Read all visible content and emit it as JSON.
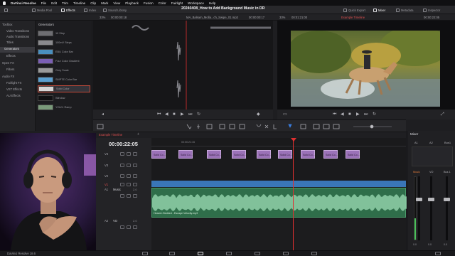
{
  "menu": {
    "app": "DaVinci Resolve",
    "items": [
      "File",
      "Edit",
      "Trim",
      "Timeline",
      "Clip",
      "Mark",
      "View",
      "Playback",
      "Fusion",
      "Color",
      "Fairlight",
      "Workspace",
      "Help"
    ]
  },
  "toolbar": {
    "left": [
      "Media Pool",
      "Effects",
      "Index",
      "Sound Library"
    ],
    "title": "20240408_How to Add Background Music in DR",
    "right": [
      "Quick Export",
      "Mixer",
      "Metadata",
      "Inspector"
    ]
  },
  "subbar": {
    "src_zoom": "33%",
    "src_timecode": "00:00:00:18",
    "src_clip": "MA_Balsam_Molla...ch_Swipe_01.mp3",
    "src_timecode_end": "00:00:00:17",
    "rec_zoom": "33%",
    "rec_timecode": "00:01:21:00",
    "rec_timeline": "Example Timeline",
    "rec_timecode_end": "00:00:22:05"
  },
  "toolbox": {
    "items": [
      "Toolbox",
      "Video Transitions",
      "Audio Transitions",
      "Titles",
      "Generators",
      "Effects",
      "Open FX",
      "Filters",
      "Audio FX",
      "Fairlight FX",
      "VST Effects",
      "AU Effects"
    ],
    "selected_index": 4
  },
  "generators": {
    "header": "Generators",
    "items": [
      {
        "label": "10 Step",
        "color": "#6e6e72"
      },
      {
        "label": "100mV Steps",
        "color": "#8a8a8e"
      },
      {
        "label": "EBU Color Bar",
        "color": "#4a8fbf"
      },
      {
        "label": "Four Color Gradient",
        "color": "#7b5fb4"
      },
      {
        "label": "Grey Scale",
        "color": "#9a9a9a"
      },
      {
        "label": "SMPTE Color Bar",
        "color": "#5a9fd0"
      },
      {
        "label": "Solid Color",
        "color": "#d6d6d6"
      },
      {
        "label": "Window",
        "color": "#101012"
      },
      {
        "label": "YCbCr Ramp",
        "color": "#7a9a7a"
      }
    ],
    "selected_index": 6
  },
  "timeline": {
    "tab": "Example Timeline",
    "timecode": "00:00:22:05",
    "ruler_mark": "00:00:21:15",
    "tracks": {
      "video": [
        "V4",
        "V3",
        "V2",
        "V1"
      ],
      "audio": [
        {
          "id": "A1",
          "name": "Music",
          "level": "2.0"
        },
        {
          "id": "A2",
          "name": "VO",
          "level": "2.0"
        }
      ]
    },
    "v4_clip_label": "Solid Co...",
    "audio_clip_label": "Heaven Bedded - Escape Velocity.mp3"
  },
  "mixer": {
    "title": "Mixer",
    "channels": [
      "A1",
      "A2",
      "Bus1"
    ],
    "music_label": "Music",
    "vo_label": "VO",
    "bus_label": "Bus 1",
    "fader_zero": "0.0"
  },
  "bottombar": {
    "brand": "DaVinci Resolve 18.6"
  },
  "colors": {
    "accent": "#e05050",
    "playhead": "#e03030",
    "video_clip": "#9b72b8",
    "audio_track": "#3b8a5a",
    "waveform": "#8fd0a8"
  }
}
